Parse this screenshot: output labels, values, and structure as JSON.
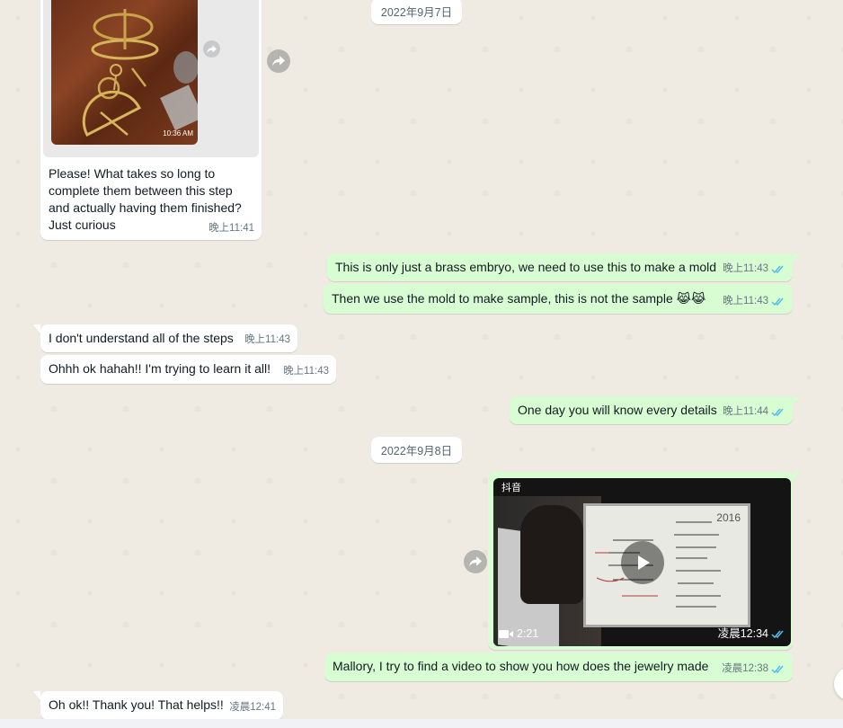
{
  "dates": {
    "first": "2022年9月7日",
    "second": "2022年9月8日"
  },
  "image_message": {
    "image_timestamp": "10:36 AM",
    "caption": [
      "Please! What takes so long to",
      "complete them between this step",
      "and actually having them finished?",
      "Just curious"
    ],
    "time": "晚上11:41"
  },
  "messages": [
    {
      "text": "This is only just a brass embryo, we need to use this to make a mold",
      "time": "晚上11:43"
    },
    {
      "text": "Then we use the mold to make sample, this is not the sample 😹😹",
      "time": "晚上11:43"
    },
    {
      "text": "I don't understand all of the steps",
      "time": "晚上11:43"
    },
    {
      "text": "Ohhh ok hahah!! I'm trying to learn it all!",
      "time": "晚上11:43"
    },
    {
      "text": "One day you will know every details",
      "time": "晚上11:44"
    },
    {
      "text": "Mallory, I try to find a video to show you how does the jewelry made",
      "time": "凌晨12:38"
    },
    {
      "text": "Oh ok!! Thank you! That helps!!",
      "time": "凌晨12:41"
    }
  ],
  "video_message": {
    "source": "抖音",
    "duration": "2:21",
    "time": "凌晨12:34",
    "board_title": "2016",
    "icons": [
      "video-camera-icon",
      "play-icon"
    ]
  },
  "colors": {
    "incoming": "#ffffff",
    "outgoing": "#d9fdd3",
    "check": "#53bdeb",
    "background": "#efeae2"
  }
}
